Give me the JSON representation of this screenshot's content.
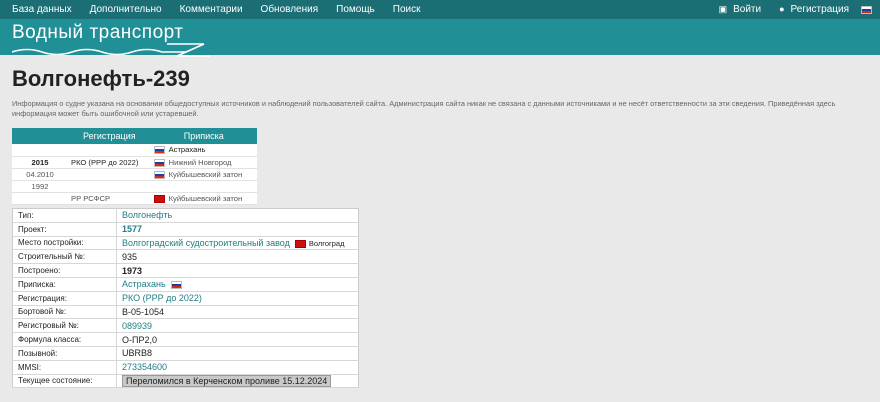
{
  "nav": {
    "items": [
      "База данных",
      "Дополнительно",
      "Комментарии",
      "Обновления",
      "Помощь",
      "Поиск"
    ],
    "login": "Войти",
    "register": "Регистрация"
  },
  "site": {
    "logo_text": "Водный транспорт"
  },
  "page": {
    "title": "Волгонефть-239",
    "disclaimer": "Информация о судне указана на основании общедоступных источников и наблюдений пользователей сайта. Администрация сайта никак не связана с данными источниками и не несёт ответственности за эти сведения. Приведённая здесь информация может быть ошибочной или устаревшей."
  },
  "registry": {
    "headers": [
      "Регистрация",
      "Приписка"
    ],
    "rows": [
      {
        "year": "",
        "registry": "",
        "port": "Астрахань",
        "flag": "ru"
      },
      {
        "year": "2015",
        "registry": "РКО (РРР до 2022)",
        "port": "Нижний Новгород",
        "flag": "ru"
      },
      {
        "year": "04.2010",
        "registry": "",
        "port": "Куйбышевский затон",
        "flag": "ru"
      },
      {
        "year": "1992",
        "registry": "",
        "port": "",
        "flag": ""
      },
      {
        "year": "",
        "registry": "РР РСФСР",
        "port": "Куйбышевский затон",
        "flag": "su"
      }
    ]
  },
  "info": {
    "type_label": "Тип:",
    "type_value": "Волгонефть",
    "project_label": "Проект:",
    "project_value": "1577",
    "place_label": "Место постройки:",
    "place_value": "Волгоградский судостроительный завод",
    "place_city": "Волгоград",
    "build_no_label": "Строительный №:",
    "build_no_value": "935",
    "built_label": "Построено:",
    "built_value": "1973",
    "home_label": "Приписка:",
    "home_value": "Астрахань",
    "reg_label": "Регистрация:",
    "reg_value": "РКО (РРР до 2022)",
    "board_label": "Бортовой №:",
    "board_value": "В-05-1054",
    "regno_label": "Регистровый №:",
    "regno_value": "089939",
    "class_label": "Формула класса:",
    "class_value": "О-ПР2,0",
    "call_label": "Позывной:",
    "call_value": "UBRB8",
    "mmsi_label": "MMSI:",
    "mmsi_value": "273354600",
    "state_label": "Текущее состояние:",
    "state_value": "Переломился в Керченском проливе 15.12.2024"
  }
}
